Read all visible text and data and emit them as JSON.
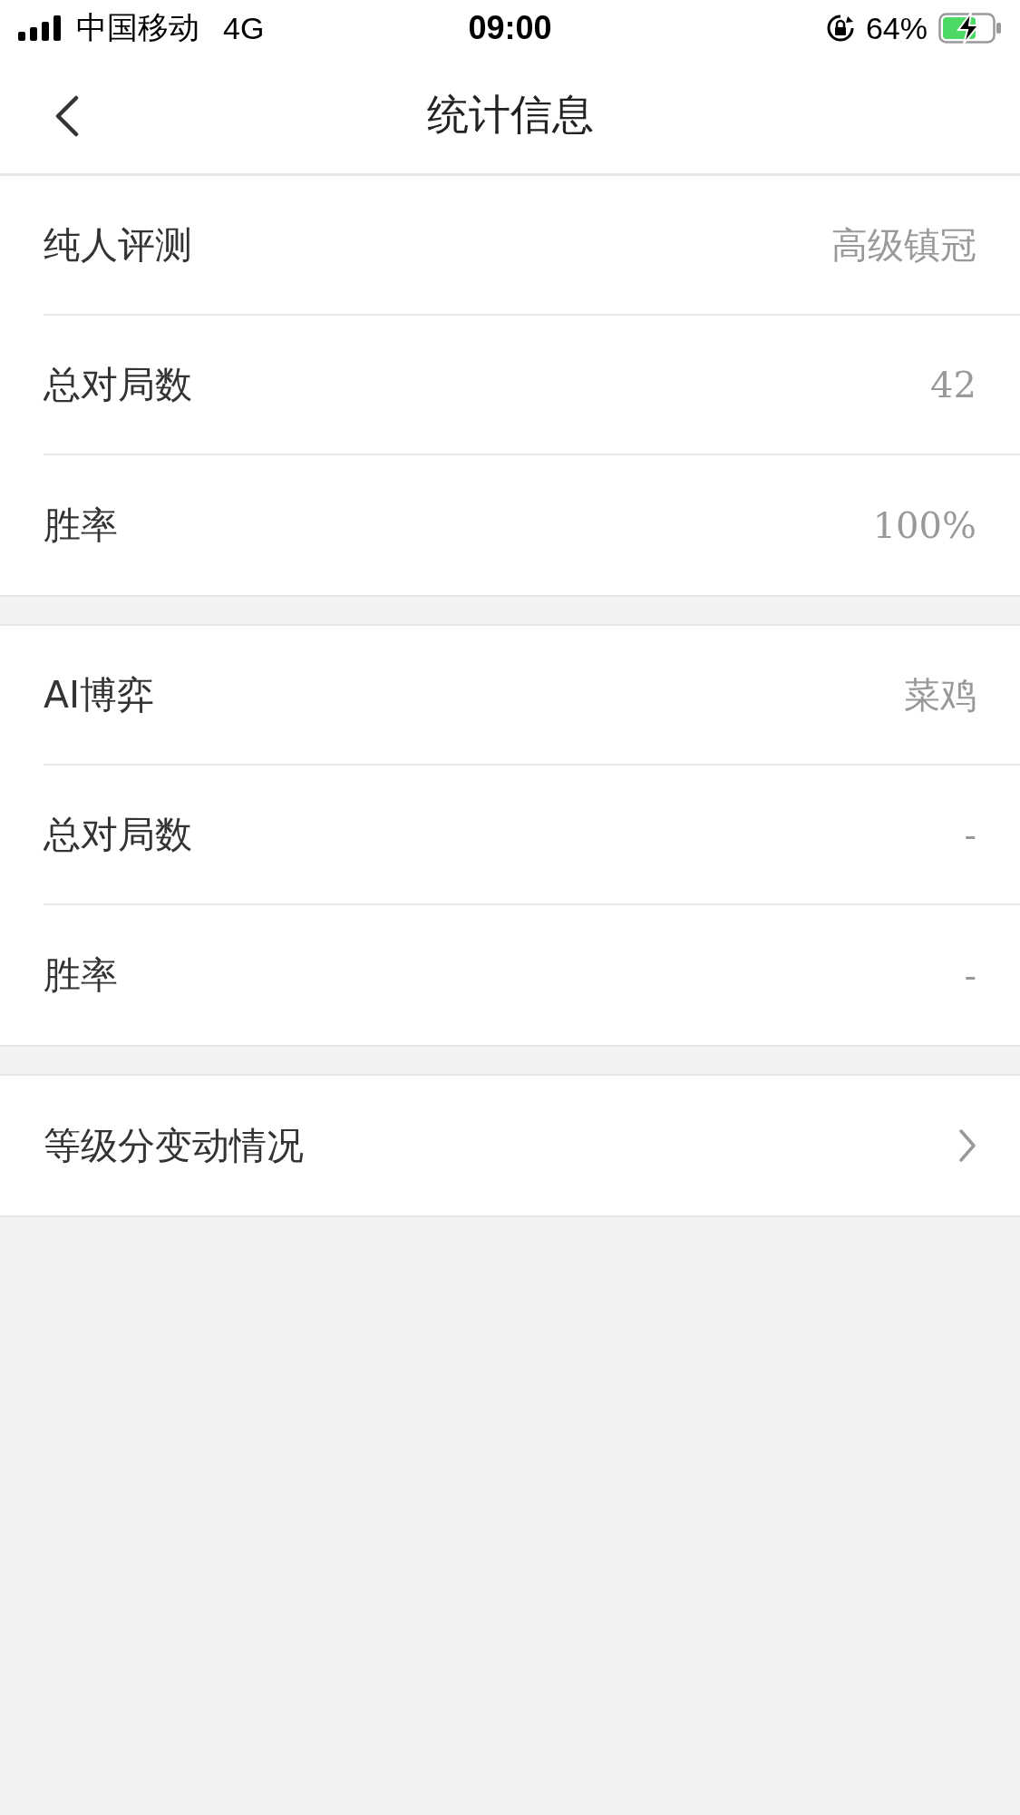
{
  "status_bar": {
    "carrier": "中国移动",
    "network": "4G",
    "time": "09:00",
    "battery_percent": "64%"
  },
  "nav": {
    "title": "统计信息"
  },
  "sections": [
    {
      "rows": [
        {
          "kind": "value",
          "label": "纯人评测",
          "value": "高级镇冠"
        },
        {
          "kind": "value",
          "label": "总对局数",
          "value": "42"
        },
        {
          "kind": "value",
          "label": "胜率",
          "value": "100%"
        }
      ]
    },
    {
      "rows": [
        {
          "kind": "value",
          "label": "AI博弈",
          "value": "菜鸡"
        },
        {
          "kind": "value",
          "label": "总对局数",
          "value": "-"
        },
        {
          "kind": "value",
          "label": "胜率",
          "value": "-"
        }
      ]
    },
    {
      "rows": [
        {
          "kind": "link",
          "label": "等级分变动情况"
        }
      ]
    }
  ]
}
